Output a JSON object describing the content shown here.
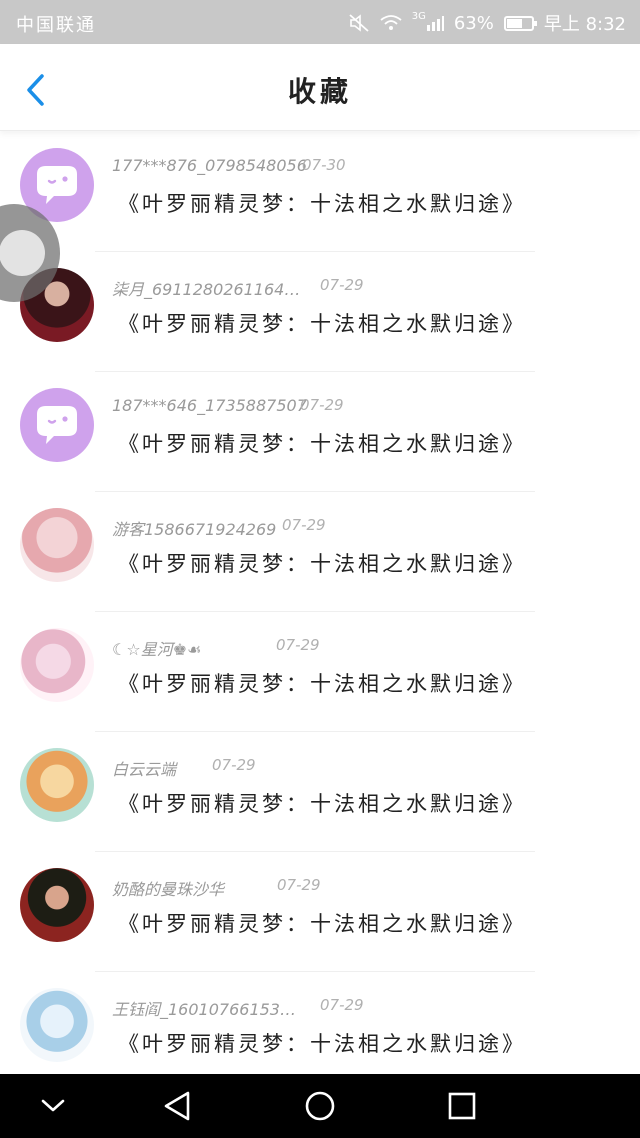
{
  "status_bar": {
    "carrier": "中国联通",
    "network": "3G",
    "battery": "63%",
    "battery_level": 0.63,
    "time": "早上 8:32"
  },
  "header": {
    "title": "收藏",
    "back_icon": "chevron-left-icon"
  },
  "colors": {
    "accent": "#1b8fe8",
    "chat_avatar": "#cfa2ec"
  },
  "items": [
    {
      "user": "177***876_0798548056",
      "date": "07-30",
      "title": "《叶罗丽精灵梦：十法相之水默归途》",
      "avatar": "chat-bubble-avatar"
    },
    {
      "user": "柒月_6911280261164…",
      "date": "07-29",
      "title": "《叶罗丽精灵梦：十法相之水默归途》",
      "avatar": "user-photo-avatar"
    },
    {
      "user": "187***646_1735887507",
      "date": "07-29",
      "title": "《叶罗丽精灵梦：十法相之水默归途》",
      "avatar": "chat-bubble-avatar"
    },
    {
      "user": "游客1586671924269",
      "date": "07-29",
      "title": "《叶罗丽精灵梦：十法相之水默归途》",
      "avatar": "user-photo-avatar"
    },
    {
      "user": "☾☆星河♚☙",
      "date": "07-29",
      "title": "《叶罗丽精灵梦：十法相之水默归途》",
      "avatar": "user-photo-avatar"
    },
    {
      "user": "白云云端",
      "date": "07-29",
      "title": "《叶罗丽精灵梦：十法相之水默归途》",
      "avatar": "user-photo-avatar"
    },
    {
      "user": "奶酪的曼珠沙华",
      "date": "07-29",
      "title": "《叶罗丽精灵梦：十法相之水默归途》",
      "avatar": "user-photo-avatar"
    },
    {
      "user": "王钰阎_16010766153…",
      "date": "07-29",
      "title": "《叶罗丽精灵梦：十法相之水默归途》",
      "avatar": "user-photo-avatar"
    }
  ],
  "nav_bar": {
    "buttons": [
      "chevron-down-icon",
      "back-triangle-icon",
      "home-circle-icon",
      "recents-square-icon"
    ]
  }
}
